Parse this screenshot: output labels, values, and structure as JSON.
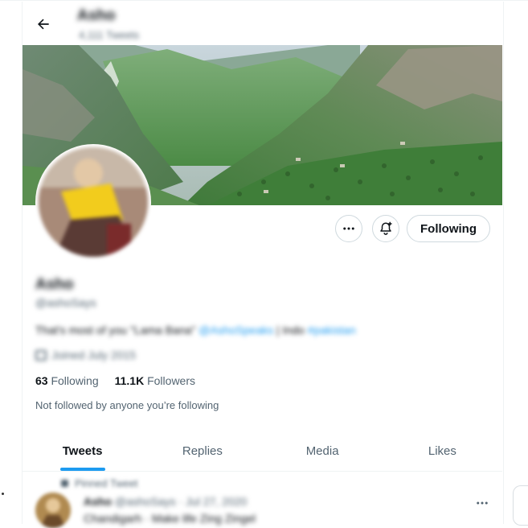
{
  "header": {
    "back_icon": "arrow-left-icon",
    "name": "Asho",
    "tweet_count": "4,111 Tweets"
  },
  "banner": {
    "description_icon": "mountain-valley-banner"
  },
  "profile": {
    "name": "Asho",
    "handle": "@ashoSays",
    "bio_text": "That's most of you \"Lama Bana\"",
    "bio_link1": "@AshoSpeaks",
    "bio_mid": "| Indo",
    "bio_link2": "#pakistan",
    "joined": "Joined July 2015",
    "following_count": "63",
    "following_label": "Following",
    "followers_count": "11.1K",
    "followers_label": "Followers",
    "not_followed": "Not followed by anyone you’re following"
  },
  "actions": {
    "more_icon": "more-horizontal-icon",
    "notify_icon": "bell-plus-icon",
    "following_label": "Following"
  },
  "tabs": [
    {
      "label": "Tweets",
      "active": true
    },
    {
      "label": "Replies",
      "active": false
    },
    {
      "label": "Media",
      "active": false
    },
    {
      "label": "Likes",
      "active": false
    }
  ],
  "tweet": {
    "pinned_label": "Pinned Tweet",
    "author": "Asho",
    "meta": "@ashoSays · Jul 27, 2020",
    "text": "Chandigarh · Make life Zing Zingel"
  },
  "colors": {
    "accent": "#1d9bf0",
    "text_primary": "#0f1419",
    "text_secondary": "#536471",
    "border": "#cfd9de"
  }
}
